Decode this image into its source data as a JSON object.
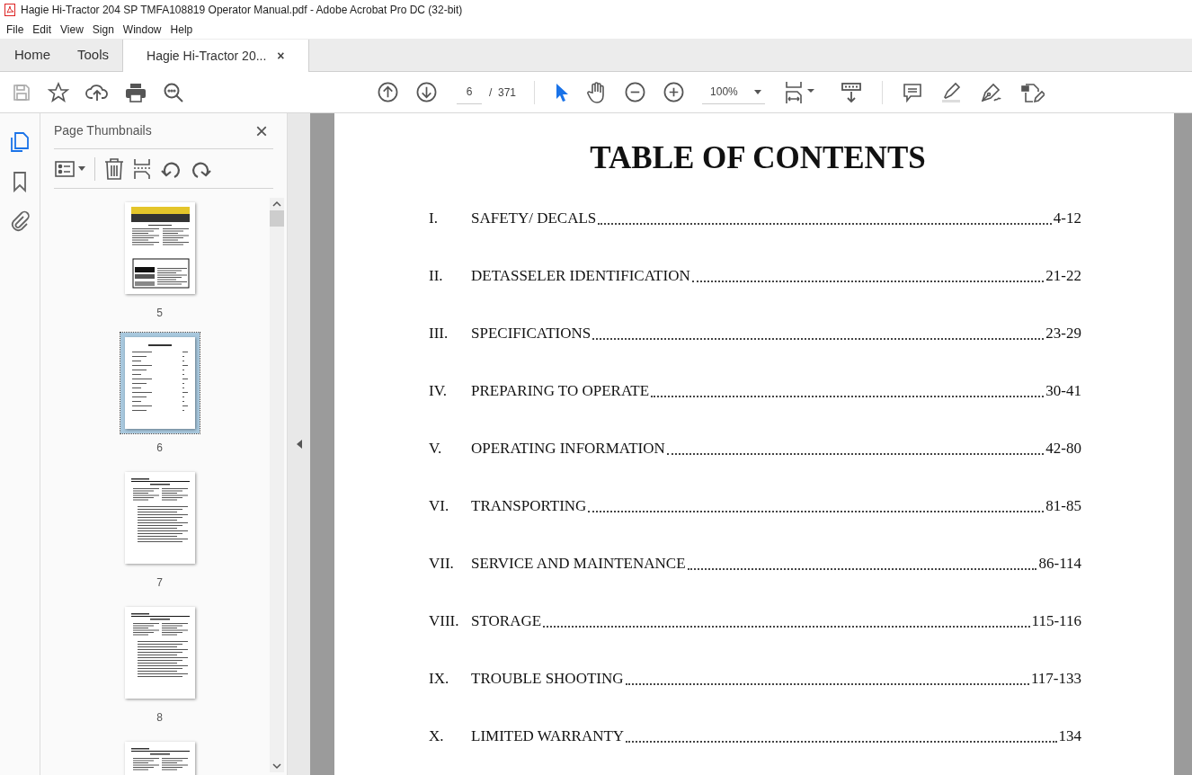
{
  "window": {
    "title": "Hagie Hi-Tractor 204 SP TMFA108819 Operator Manual.pdf - Adobe Acrobat Pro DC (32-bit)"
  },
  "menu": [
    "File",
    "Edit",
    "View",
    "Sign",
    "Window",
    "Help"
  ],
  "tabs": [
    {
      "label": "Home",
      "selected": false,
      "kind": "nav"
    },
    {
      "label": "Tools",
      "selected": false,
      "kind": "nav"
    },
    {
      "label": "Hagie Hi-Tractor 20...",
      "selected": true,
      "kind": "document",
      "close": "×"
    }
  ],
  "toolbar": {
    "page_number": "6",
    "page_total": "/  371",
    "zoom": "100%"
  },
  "rail": [
    {
      "kind": "pages",
      "selected": true
    },
    {
      "kind": "bookmarks",
      "selected": false
    },
    {
      "kind": "attachments",
      "selected": false
    }
  ],
  "sidebar": {
    "title": "Page Thumbnails",
    "close": "×",
    "thumbnails": [
      {
        "kind": "caution",
        "label": "5",
        "selected": false
      },
      {
        "kind": "toc",
        "label": "6",
        "selected": true
      },
      {
        "kind": "text",
        "label": "7",
        "selected": false
      },
      {
        "kind": "text",
        "label": "8",
        "selected": false
      },
      {
        "kind": "text",
        "selected": false
      }
    ]
  },
  "document": {
    "heading": "TABLE OF CONTENTS",
    "entries": [
      {
        "numeral": "I.",
        "title": "SAFETY/ DECALS",
        "pages": "4-12"
      },
      {
        "numeral": "II.",
        "title": "DETASSELER IDENTIFICATION",
        "pages": "21-22"
      },
      {
        "numeral": "III.",
        "title": "SPECIFICATIONS",
        "pages": "23-29"
      },
      {
        "numeral": "IV.",
        "title": "PREPARING TO OPERATE",
        "pages": "30-41"
      },
      {
        "numeral": "V.",
        "title": "OPERATING INFORMATION",
        "pages": "42-80"
      },
      {
        "numeral": "VI.",
        "title": "TRANSPORTING",
        "pages": "81-85"
      },
      {
        "numeral": "VII.",
        "title": "SERVICE AND MAINTENANCE",
        "pages": "86-114"
      },
      {
        "numeral": "VIII.",
        "title": "STORAGE",
        "pages": "115-116"
      },
      {
        "numeral": "IX.",
        "title": "TROUBLE SHOOTING",
        "pages": "117-133"
      },
      {
        "numeral": "X.",
        "title": "LIMITED WARRANTY",
        "pages": "134"
      }
    ]
  }
}
